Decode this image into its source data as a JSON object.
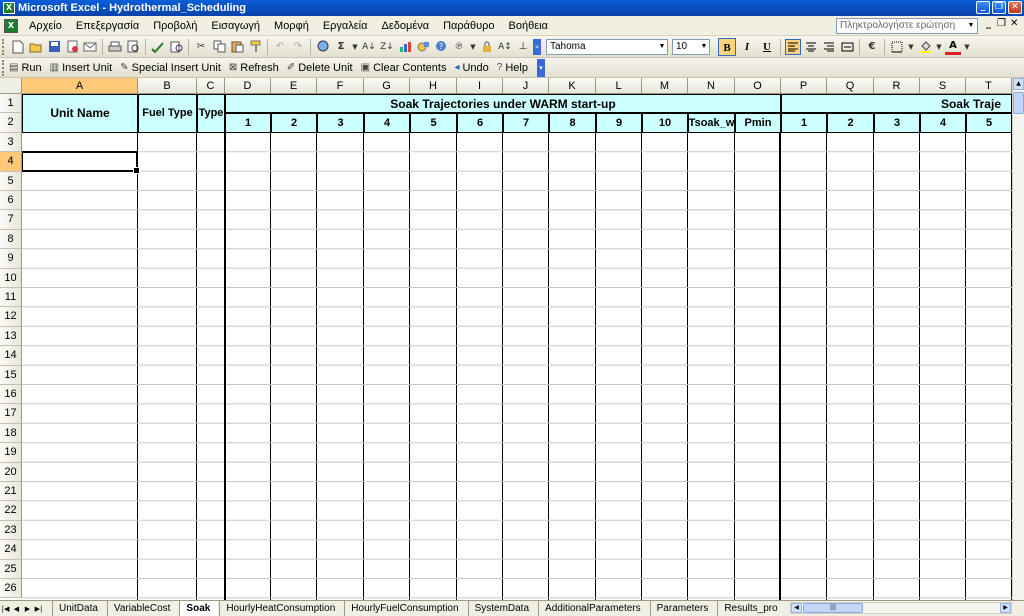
{
  "window": {
    "title": "Microsoft Excel - Hydrothermal_Scheduling",
    "app_icon": "X",
    "buttons": [
      "_",
      "❐",
      "✕"
    ]
  },
  "menubar": {
    "items": [
      "Αρχείο",
      "Επεξεργασία",
      "Προβολή",
      "Εισαγωγή",
      "Μορφή",
      "Εργαλεία",
      "Δεδομένα",
      "Παράθυρο",
      "Βοήθεια"
    ],
    "ask_placeholder": "Πληκτρολογήστε ερώτηση",
    "doc_buttons": [
      "_",
      "❐",
      "✕"
    ]
  },
  "toolbar": {
    "font_name": "Tahoma",
    "font_size": "10",
    "bold": "B",
    "italic": "I",
    "underline": "U",
    "euro": "€",
    "bold_active": true
  },
  "macro_toolbar": {
    "items": [
      {
        "label": "Run",
        "icon": "run-icon"
      },
      {
        "label": "Insert Unit",
        "icon": "insert-unit-icon"
      },
      {
        "label": "Special Insert Unit",
        "icon": "special-insert-icon"
      },
      {
        "label": "Refresh",
        "icon": "refresh-icon"
      },
      {
        "label": "Delete Unit",
        "icon": "delete-icon"
      },
      {
        "label": "Clear Contents",
        "icon": "clear-icon"
      },
      {
        "label": "Undo",
        "icon": "undo-icon"
      },
      {
        "label": "Help",
        "icon": "help-icon"
      }
    ]
  },
  "sheet": {
    "columns": [
      "A",
      "B",
      "C",
      "D",
      "E",
      "F",
      "G",
      "H",
      "I",
      "J",
      "K",
      "L",
      "M",
      "N",
      "O",
      "P",
      "Q",
      "R",
      "S",
      "T"
    ],
    "rows": [
      "1",
      "2",
      "3",
      "4",
      "5",
      "6",
      "7",
      "8",
      "9",
      "10",
      "11",
      "12",
      "13",
      "14",
      "15",
      "16",
      "17",
      "18",
      "19",
      "20",
      "21",
      "22",
      "23",
      "24",
      "25",
      "26"
    ],
    "selected_column": "A",
    "selected_row": "4",
    "headers": {
      "unit_name": "Unit Name",
      "fuel_type": "Fuel Type",
      "type": "Type",
      "warm_group": "Soak Trajectories under WARM start-up",
      "hot_group": "Soak Traje",
      "warm_subheaders": [
        "1",
        "2",
        "3",
        "4",
        "5",
        "6",
        "7",
        "8",
        "9",
        "10",
        "Tsoak_w",
        "Pmin"
      ],
      "hot_subheaders": [
        "1",
        "2",
        "3",
        "4",
        "5"
      ]
    },
    "header_fill": "#ccffff"
  },
  "tabs": {
    "items": [
      "UnitData",
      "VariableCost",
      "Soak",
      "HourlyHeatConsumption",
      "HourlyFuelConsumption",
      "SystemData",
      "AdditionalParameters",
      "Parameters",
      "Results_pro"
    ],
    "active": "Soak"
  }
}
